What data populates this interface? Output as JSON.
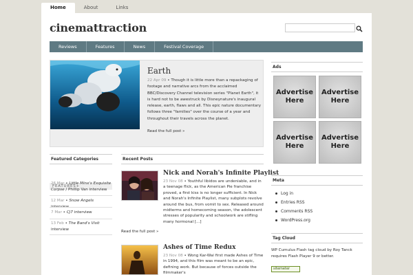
{
  "topnav": {
    "tabs": [
      "Home",
      "About",
      "Links"
    ]
  },
  "site": {
    "title": "cinemattraction"
  },
  "catnav": {
    "items": [
      "Reviews",
      "Features",
      "News",
      "Festival Coverage"
    ]
  },
  "feature": {
    "title": "Earth",
    "date": "22 Apr 09",
    "text": "Though it is little more than a repackaging of footage and narrative arcs from the acclaimed BBC/Discovery Channel television series \"Planet Earth\", it is hard not to be awestruck by Disneynature's inaugural release, earth, flaws and all. This epic nature documentary follows three \"families\" over the course of a year and throughout their travels across the planet.",
    "readmore": "Read the full post »"
  },
  "ads": {
    "heading": "Ads",
    "items": [
      "Advertise Here",
      "Advertise Here",
      "Advertise Here",
      "Advertise Here"
    ]
  },
  "featured_categories": {
    "heading": "Featured Categories",
    "label": "FEATURES+",
    "items": [
      {
        "date": "26 Mar",
        "sep": " • ",
        "title": "Little Minx's Exquisite Corpse",
        "rest": " / Phillip Van interview"
      },
      {
        "date": "12 Mar",
        "sep": " • ",
        "title": "Snow Angels",
        "rest": " interview"
      },
      {
        "date": "7 Mar",
        "sep": " • ",
        "title": "CJ7",
        "rest": " interview"
      },
      {
        "date": "13 Feb",
        "sep": " • ",
        "title": "The Band's Visit",
        "rest": " interview"
      }
    ]
  },
  "recent_posts": {
    "heading": "Recent Posts",
    "posts": [
      {
        "title": "Nick and Norah's Infinite Playlist",
        "date": "23 Nov 08",
        "text": "Youthful libidos are undeniable, and in a teenage flick, as the American Pie franchise proved, a first kiss is no longer sufficient. In Nick and Norah's Infinite Playlist, many subplots revolve around the bus, from vomit to sex. Released around midterms and homecoming season, the adolescent stresses of popularity and schoolwork are stifling many hormonal [...]",
        "readmore": "Read the full post »"
      },
      {
        "title": "Ashes of Time Redux",
        "date": "23 Nov 08",
        "text": "Wong Kar-Wai first made Ashes of Time in 1994, and this film was meant to be an epic, defining work. But because of forces outside the filmmaker's"
      }
    ]
  },
  "meta": {
    "heading": "Meta",
    "items": [
      "Log in",
      "Entries RSS",
      "Comments RSS",
      "WordPress.org"
    ]
  },
  "tagcloud": {
    "heading": "Tag Cloud",
    "text": "WP Cumulus Flash tag cloud by Roy Tanck requires Flash Player 9 or better.",
    "badge": "sitemeter"
  },
  "icons": {
    "search": "magnifier-icon"
  },
  "colors": {
    "catnav": "#5f7a83",
    "background": "#e3e1d9",
    "feature_box": "#eeeeee"
  }
}
